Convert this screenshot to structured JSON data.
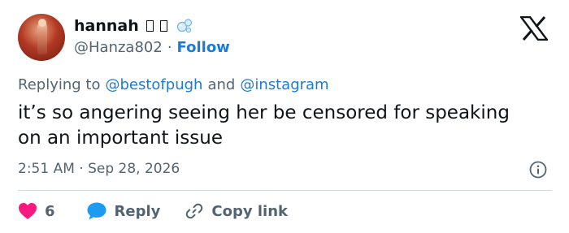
{
  "author": {
    "display_name": "hannah",
    "handle": "@Hanza802",
    "separator": "·",
    "follow_label": "Follow"
  },
  "reply_context": {
    "prefix": "Replying to",
    "mention_1": "@bestofpugh",
    "conjunction": "and",
    "mention_2": "@instagram"
  },
  "tweet": {
    "text": "it’s so angering seeing her be censored for speaking on an important issue",
    "timestamp": "2:51 AM · Sep 28, 2026"
  },
  "actions": {
    "like_count": "6",
    "reply_label": "Reply",
    "copy_link_label": "Copy link"
  },
  "icons": {
    "platform": "x-logo-icon",
    "info": "info-icon",
    "like": "heart-icon",
    "reply": "speech-bubble-icon",
    "copy": "link-icon",
    "emoji": "bubbles-icon"
  },
  "colors": {
    "link": "#1d7bd8",
    "heart": "#f91880",
    "reply_bubble": "#1d9bf0",
    "secondary_text": "#536471"
  }
}
